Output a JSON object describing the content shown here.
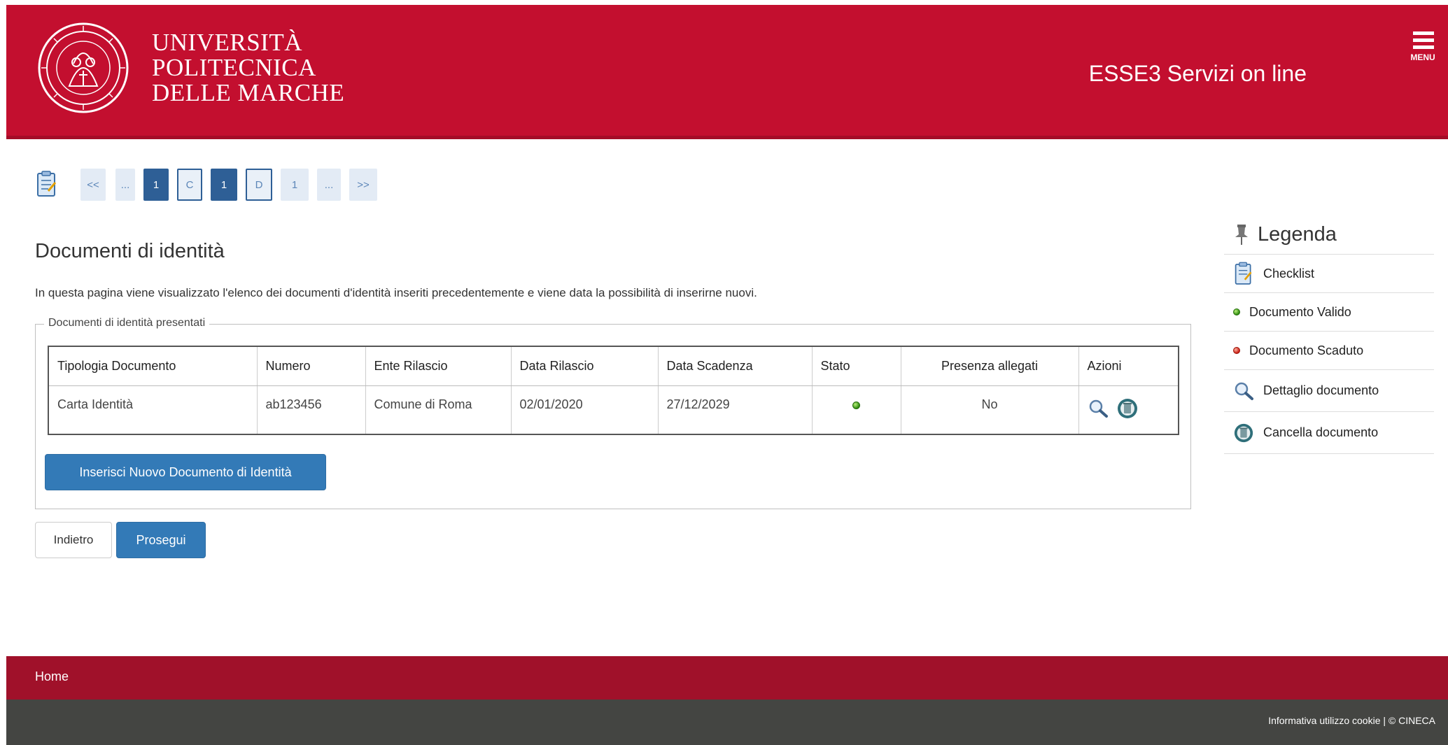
{
  "header": {
    "logo_lines": [
      "UNIVERSITÀ",
      "POLITECNICA",
      "DELLE MARCHE"
    ],
    "service_name": "ESSE3 Servizi on line",
    "menu_label": "MENU",
    "brand_color": "#c30f2f"
  },
  "stepper": {
    "icon": "checklist-icon",
    "steps": [
      "<<",
      "...",
      "1",
      "C",
      "1",
      "D",
      "1",
      "...",
      ">>"
    ]
  },
  "main": {
    "title": "Documenti di identità",
    "intro": "In questa pagina viene visualizzato l'elenco dei documenti d'identità inseriti precedentemente e viene data la possibilità di inserirne nuovi.",
    "fieldset_legend": "Documenti di identità presentati",
    "table": {
      "headers": [
        "Tipologia Documento",
        "Numero",
        "Ente Rilascio",
        "Data Rilascio",
        "Data Scadenza",
        "Stato",
        "Presenza allegati",
        "Azioni"
      ],
      "rows": [
        {
          "tipologia": "Carta Identità",
          "numero": "ab123456",
          "ente": "Comune di Roma",
          "data_rilascio": "02/01/2020",
          "data_scadenza": "27/12/2029",
          "stato": "valid-status-icon",
          "allegati": "No",
          "azioni": [
            "magnifier-icon",
            "trash-icon"
          ]
        }
      ]
    },
    "insert_button": "Inserisci Nuovo Documento di Identità",
    "back_button": "Indietro",
    "next_button": "Prosegui"
  },
  "legenda": {
    "title": "Legenda",
    "items": [
      {
        "icon": "checklist-icon",
        "label": "Checklist"
      },
      {
        "icon": "green-dot-icon",
        "label": "Documento Valido"
      },
      {
        "icon": "red-dot-icon",
        "label": "Documento Scaduto"
      },
      {
        "icon": "magnifier-icon",
        "label": "Dettaglio documento"
      },
      {
        "icon": "trash-icon",
        "label": "Cancella documento"
      }
    ]
  },
  "footer": {
    "home_link": "Home",
    "cookie_text": "Informativa utilizzo cookie | © CINECA"
  }
}
